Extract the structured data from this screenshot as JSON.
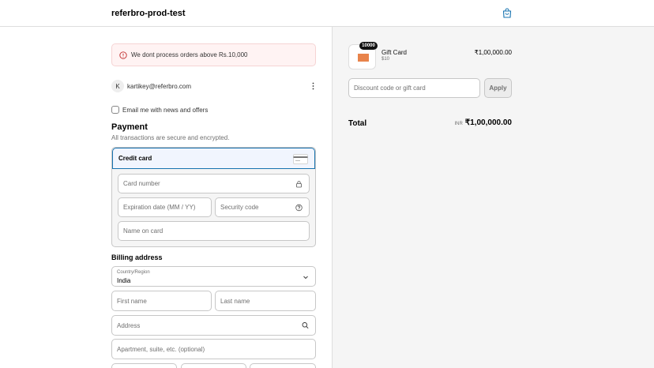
{
  "header": {
    "store_name": "referbro-prod-test"
  },
  "alert": {
    "message": "We dont process orders above Rs.10,000"
  },
  "account": {
    "initial": "K",
    "email": "kartikey@referbro.com"
  },
  "newsletter": {
    "label": "Email me with news and offers"
  },
  "payment": {
    "title": "Payment",
    "subtitle": "All transactions are secure and encrypted.",
    "method_label": "Credit card",
    "card_number_placeholder": "Card number",
    "expiry_placeholder": "Expiration date (MM / YY)",
    "security_placeholder": "Security code",
    "name_placeholder": "Name on card"
  },
  "billing": {
    "title": "Billing address",
    "country_label": "Country/Region",
    "country_value": "India",
    "first_name_placeholder": "First name",
    "last_name_placeholder": "Last name",
    "address_placeholder": "Address",
    "apartment_placeholder": "Apartment, suite, etc. (optional)"
  },
  "summary": {
    "product_name": "Gift Card",
    "product_variant": "$10",
    "quantity": "10000",
    "product_price": "₹1,00,000.00",
    "discount_placeholder": "Discount code or gift card",
    "apply_label": "Apply",
    "total_label": "Total",
    "currency": "INR",
    "total_value": "₹1,00,000.00"
  },
  "colors": {
    "accent": "#1773b0",
    "alert_bg": "#fff3f3",
    "product_image": "#e8834b"
  },
  "icons": {
    "cart": "bag-icon",
    "alert": "alert-circle-icon",
    "menu": "kebab-icon",
    "lock": "lock-icon",
    "help": "help-circle-icon",
    "search": "search-icon",
    "chevron": "chevron-down-icon",
    "card": "credit-card-icon"
  }
}
